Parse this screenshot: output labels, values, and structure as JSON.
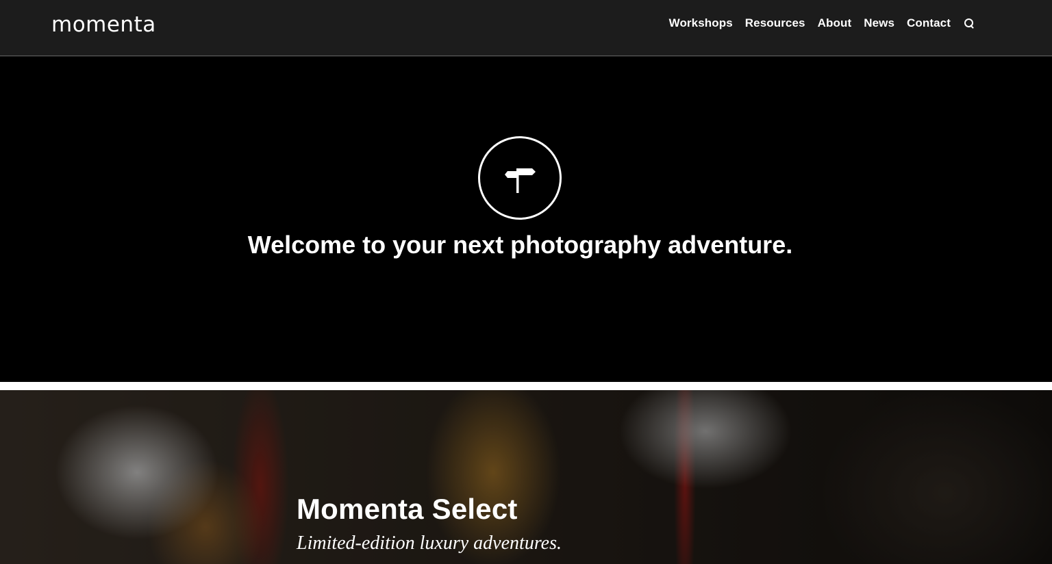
{
  "header": {
    "logo": "momenta",
    "nav": [
      "Workshops",
      "Resources",
      "About",
      "News",
      "Contact"
    ],
    "search_icon": "search-icon"
  },
  "hero": {
    "icon": "signpost-icon",
    "title": "Welcome to your next photography adventure."
  },
  "banner": {
    "title": "Momenta Select",
    "subtitle": "Limited-edition luxury adventures."
  }
}
